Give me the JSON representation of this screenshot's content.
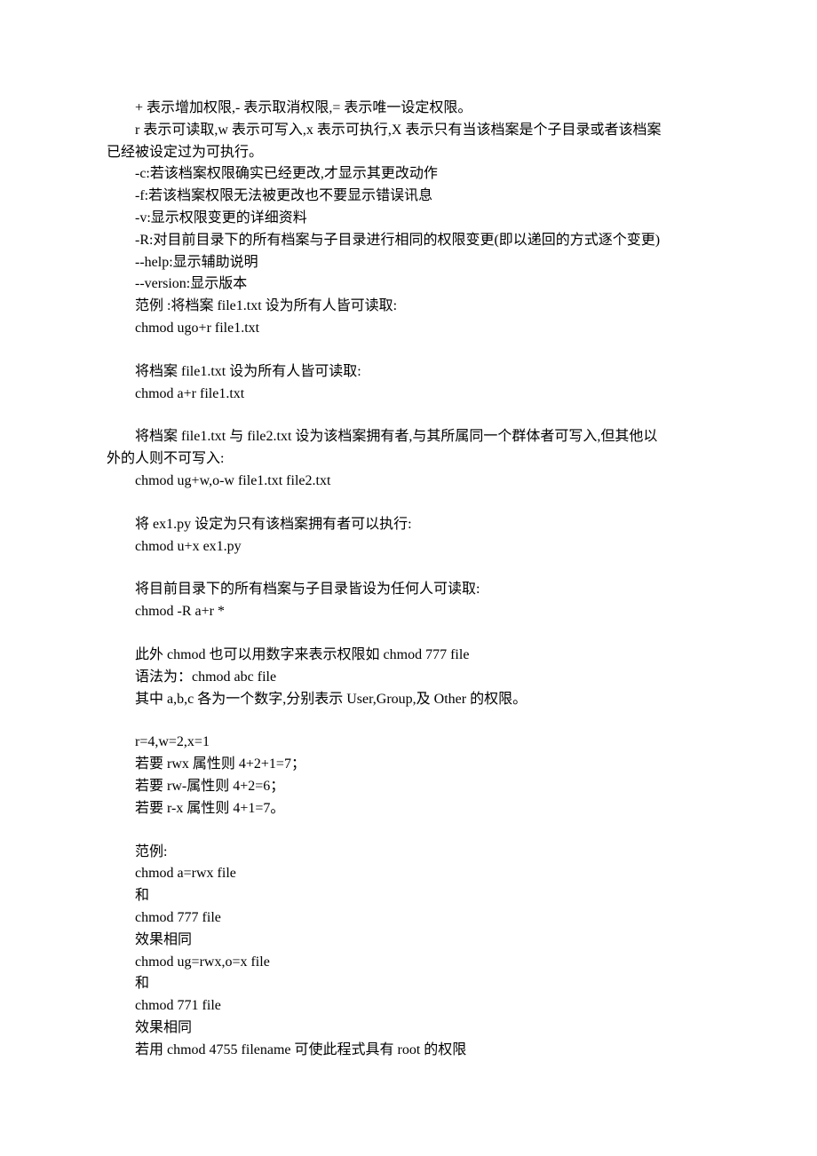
{
  "lines": [
    {
      "cls": "indent",
      "text": "+ 表示增加权限,- 表示取消权限,= 表示唯一设定权限。"
    },
    {
      "cls": "indent",
      "text": "r 表示可读取,w 表示可写入,x 表示可执行,X 表示只有当该档案是个子目录或者该档案"
    },
    {
      "cls": "no-indent",
      "text": "已经被设定过为可执行。"
    },
    {
      "cls": "indent",
      "text": "-c:若该档案权限确实已经更改,才显示其更改动作"
    },
    {
      "cls": "indent",
      "text": "-f:若该档案权限无法被更改也不要显示错误讯息"
    },
    {
      "cls": "indent",
      "text": "-v:显示权限变更的详细资料"
    },
    {
      "cls": "indent",
      "text": "-R:对目前目录下的所有档案与子目录进行相同的权限变更(即以递回的方式逐个变更)"
    },
    {
      "cls": "indent",
      "text": "--help:显示辅助说明"
    },
    {
      "cls": "indent",
      "text": "--version:显示版本"
    },
    {
      "cls": "indent",
      "text": "范例 :将档案 file1.txt 设为所有人皆可读取:"
    },
    {
      "cls": "indent",
      "text": "chmod ugo+r file1.txt"
    },
    {
      "cls": "blank",
      "text": ""
    },
    {
      "cls": "indent",
      "text": "将档案 file1.txt 设为所有人皆可读取:"
    },
    {
      "cls": "indent",
      "text": "chmod a+r file1.txt"
    },
    {
      "cls": "blank",
      "text": ""
    },
    {
      "cls": "indent",
      "text": "将档案 file1.txt 与 file2.txt 设为该档案拥有者,与其所属同一个群体者可写入,但其他以"
    },
    {
      "cls": "no-indent",
      "text": "外的人则不可写入:"
    },
    {
      "cls": "indent",
      "text": "chmod ug+w,o-w file1.txt file2.txt"
    },
    {
      "cls": "blank",
      "text": ""
    },
    {
      "cls": "indent",
      "text": "将 ex1.py 设定为只有该档案拥有者可以执行:"
    },
    {
      "cls": "indent",
      "text": "chmod u+x ex1.py"
    },
    {
      "cls": "blank",
      "text": ""
    },
    {
      "cls": "indent",
      "text": "将目前目录下的所有档案与子目录皆设为任何人可读取:"
    },
    {
      "cls": "indent",
      "text": "chmod -R a+r *"
    },
    {
      "cls": "blank",
      "text": ""
    },
    {
      "cls": "indent",
      "text": "此外 chmod 也可以用数字来表示权限如 chmod 777 file"
    },
    {
      "cls": "indent",
      "text": "语法为：chmod abc file"
    },
    {
      "cls": "indent",
      "text": "其中 a,b,c 各为一个数字,分别表示 User,Group,及 Other 的权限。"
    },
    {
      "cls": "blank",
      "text": ""
    },
    {
      "cls": "indent",
      "text": "r=4,w=2,x=1"
    },
    {
      "cls": "indent",
      "text": "若要 rwx 属性则 4+2+1=7；"
    },
    {
      "cls": "indent",
      "text": "若要 rw-属性则 4+2=6；"
    },
    {
      "cls": "indent",
      "text": "若要 r-x 属性则 4+1=7。"
    },
    {
      "cls": "blank",
      "text": ""
    },
    {
      "cls": "indent",
      "text": "范例:"
    },
    {
      "cls": "indent",
      "text": "chmod a=rwx file"
    },
    {
      "cls": "indent",
      "text": "和"
    },
    {
      "cls": "indent",
      "text": "chmod 777 file"
    },
    {
      "cls": "indent",
      "text": "效果相同"
    },
    {
      "cls": "indent",
      "text": "chmod ug=rwx,o=x file"
    },
    {
      "cls": "indent",
      "text": "和"
    },
    {
      "cls": "indent",
      "text": "chmod 771 file"
    },
    {
      "cls": "indent",
      "text": "效果相同"
    },
    {
      "cls": "indent",
      "text": "若用 chmod 4755 filename 可使此程式具有 root 的权限"
    }
  ]
}
